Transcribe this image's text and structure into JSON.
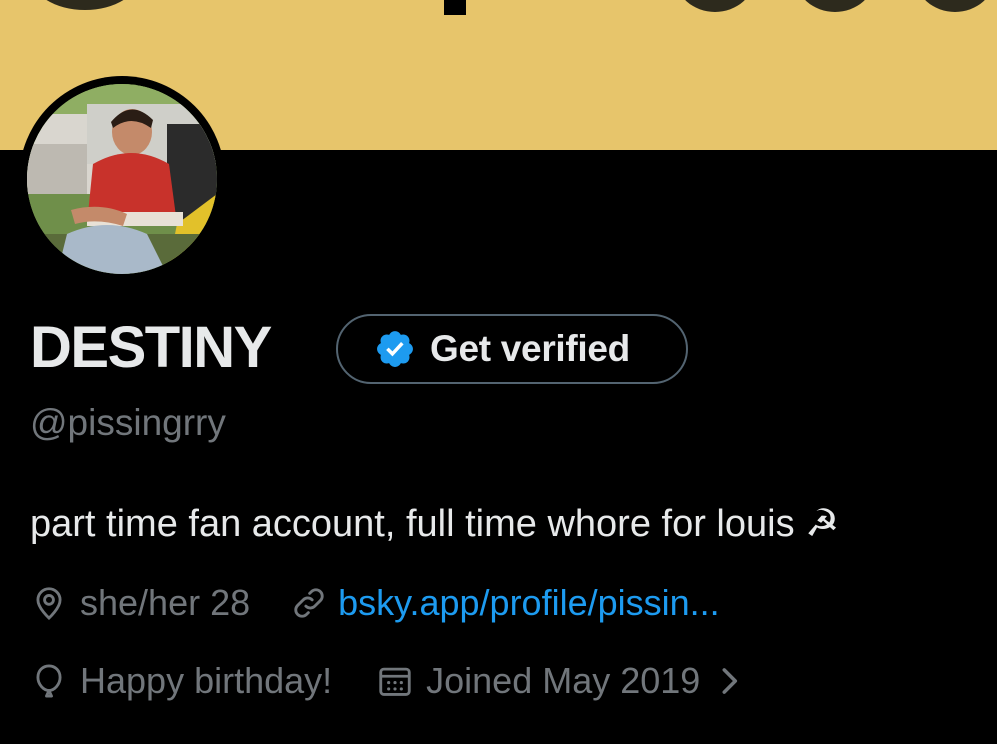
{
  "profile": {
    "display_name": "DESTINY",
    "handle": "@pissingrry",
    "bio": "part time fan account, full time whore for louis ☭",
    "verify_button_label": "Get verified",
    "pronouns_location": "she/her 28",
    "website": "bsky.app/profile/pissin...",
    "birthday_text": "Happy birthday!",
    "joined_text": "Joined May 2019"
  },
  "colors": {
    "banner": "#e7c56b",
    "background": "#000000",
    "primary_text": "#e7e9ea",
    "secondary_text": "#71767b",
    "link": "#1d9bf0",
    "verified_badge": "#1d9bf0"
  },
  "icons": {
    "location": "location-pin-icon",
    "link": "link-icon",
    "birthday": "balloon-icon",
    "joined": "calendar-icon",
    "verified": "verified-badge-icon",
    "chevron": "chevron-right-icon"
  }
}
